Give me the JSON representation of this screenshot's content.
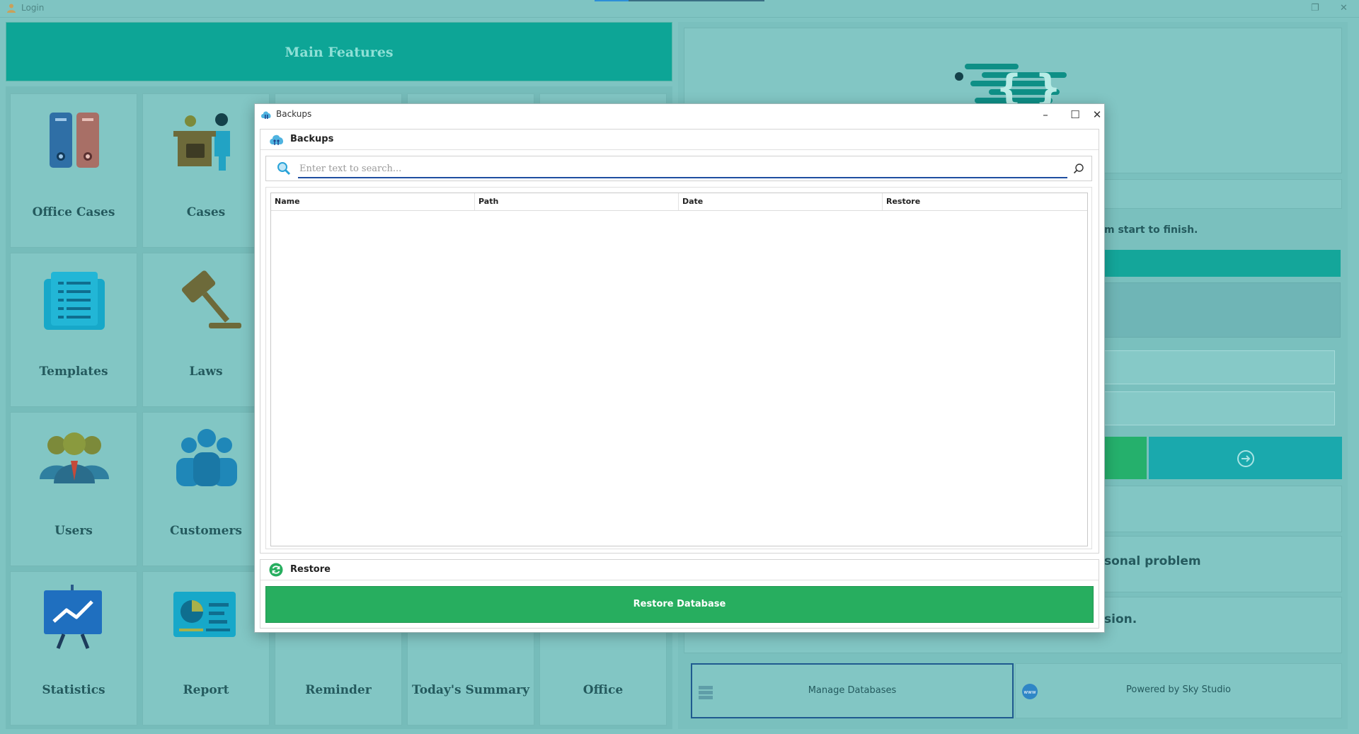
{
  "window": {
    "title": "Login"
  },
  "left_panel": {
    "header": "Main Features",
    "tiles": [
      {
        "label": "Office Cases",
        "icon": "binders-icon"
      },
      {
        "label": "Cases",
        "icon": "case-meeting-icon"
      },
      {
        "label": "Templates",
        "icon": "document-list-icon"
      },
      {
        "label": "Laws",
        "icon": "gavel-icon"
      },
      {
        "label": "Users",
        "icon": "users-group-icon"
      },
      {
        "label": "Customers",
        "icon": "customers-group-icon"
      },
      {
        "label": "Statistics",
        "icon": "trend-board-icon"
      },
      {
        "label": "Report",
        "icon": "report-chart-icon"
      },
      {
        "label": "Reminder",
        "icon": "reminder-icon"
      },
      {
        "label": "Today's Summary",
        "icon": "summary-icon"
      },
      {
        "label": "Office",
        "icon": "office-icon"
      }
    ]
  },
  "right_panel": {
    "hint_text": "m start to finish.",
    "problem_text": "sonal problem",
    "session_text": "sion.",
    "manage_databases": "Manage Databases",
    "powered_by": "Powered by Sky Studio"
  },
  "dialog": {
    "title": "Backups",
    "backups_group": "Backups",
    "search_placeholder": "Enter text to search...",
    "columns": [
      "Name",
      "Path",
      "Date",
      "Restore"
    ],
    "rows": [],
    "restore_group": "Restore",
    "restore_button": "Restore Database"
  },
  "colors": {
    "accent_teal": "#0da596",
    "background_teal": "#7fc4c2",
    "restore_green": "#27ae5f",
    "search_underline": "#1f4ea0"
  }
}
